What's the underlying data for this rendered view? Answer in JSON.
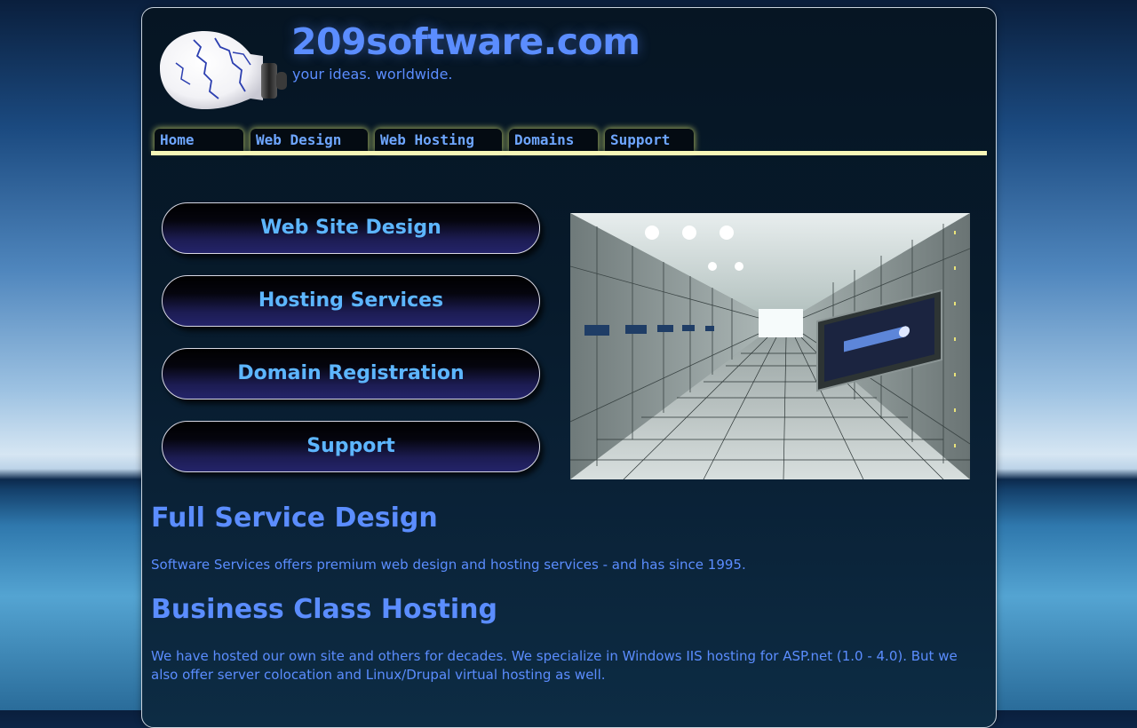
{
  "header": {
    "title": "209software.com",
    "tagline": "your ideas. worldwide."
  },
  "nav": {
    "tabs": [
      {
        "label": "Home"
      },
      {
        "label": "Web Design"
      },
      {
        "label": "Web Hosting"
      },
      {
        "label": "Domains"
      },
      {
        "label": "Support"
      }
    ]
  },
  "services": [
    {
      "label": "Web Site Design"
    },
    {
      "label": "Hosting Services"
    },
    {
      "label": "Domain Registration"
    },
    {
      "label": "Support"
    }
  ],
  "content": {
    "section1_title": "Full Service Design",
    "section1_text": "Software Services offers premium web design and hosting services - and has since 1995.",
    "section2_title": "Business Class Hosting",
    "section2_text": "We have hosted our own site and others for decades. We specialize in Windows IIS hosting for ASP.net (1.0 - 4.0). But we also offer server colocation and Linux/Drupal virtual hosting as well."
  },
  "icons": {
    "logo": "lightbulb-globe-icon",
    "photo": "server-room-image"
  },
  "colors": {
    "accent": "#5b8dff",
    "button_text": "#5db6ff",
    "nav_underline": "#f7f7b8",
    "panel_bg": "#071a2b"
  }
}
